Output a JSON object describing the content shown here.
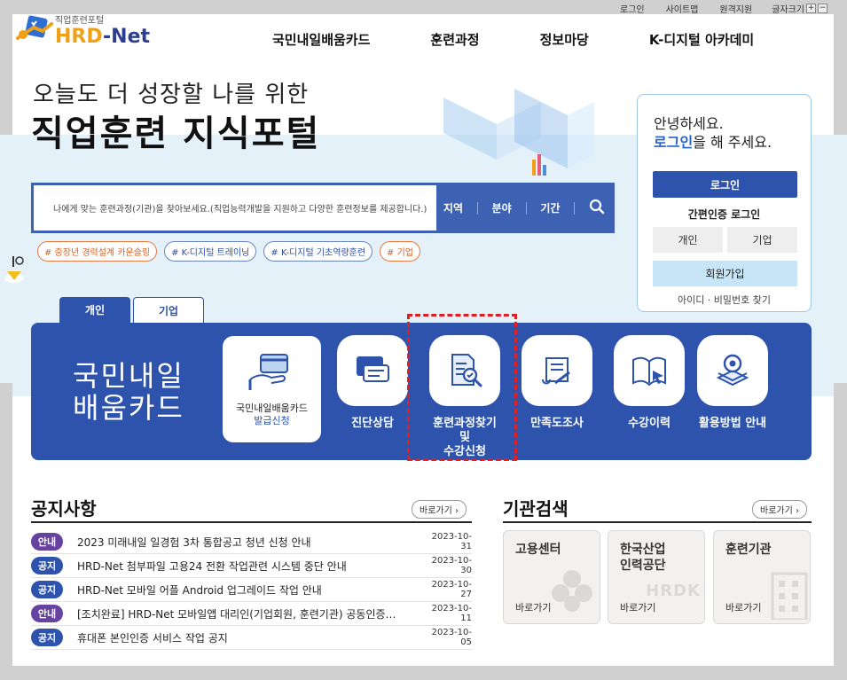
{
  "topbar": {
    "login": "로그인",
    "sitemap": "사이트맵",
    "remote": "원격지원",
    "font_size": "글자크기",
    "plus": "+",
    "minus": "−"
  },
  "logo": {
    "sub": "직업훈련포털",
    "main_a": "HRD",
    "main_b": "-Net"
  },
  "gnb": [
    "국민내일배움카드",
    "훈련과정",
    "정보마당",
    "K-디지털 아카데미"
  ],
  "hero": {
    "line1": "오늘도 더 성장할 나를 위한",
    "line2": "직업훈련 지식포털"
  },
  "search": {
    "placeholder": "나에게 맞는 훈련과정(기관)을 찾아보세요.(직업능력개발을 지원하고 다양한 훈련정보를 제공합니다.)",
    "filters": [
      "지역",
      "분야",
      "기간"
    ]
  },
  "tags": [
    "# 중장년 경력설계 카운슬링",
    "# K-디지털 트레이닝",
    "# K-디지털 기초역량훈련",
    "# 기업"
  ],
  "login_box": {
    "greet1": "안녕하세요.",
    "greet2a": "로그인",
    "greet2b": "을 해 주세요.",
    "login_btn": "로그인",
    "simple_login": "간편인증 로그인",
    "personal": "개인",
    "company": "기업",
    "join": "회원가입",
    "find": "아이디 · 비밀번호 찾기"
  },
  "tabs": {
    "personal": "개인",
    "company": "기업"
  },
  "panel": {
    "title1": "국민내일",
    "title2": "배움카드",
    "card_label1": "국민내일배움카드",
    "card_label2": "발급신청",
    "services": [
      {
        "label": "진단상담",
        "icon": "help-chat-icon"
      },
      {
        "label1": "훈련과정찾기 및",
        "label2": "수강신청",
        "icon": "document-search-icon"
      },
      {
        "label": "만족도조사",
        "icon": "survey-scroll-icon"
      },
      {
        "label": "수강이력",
        "icon": "book-cursor-icon"
      },
      {
        "label": "활용방법 안내",
        "icon": "gear-stack-icon"
      }
    ]
  },
  "notice": {
    "title": "공지사항",
    "more": "바로가기",
    "items": [
      {
        "badge": "안내",
        "text": "2023 미래내일 일경험 3차 통합공고 청년 신청 안내",
        "date": "2023-10-31"
      },
      {
        "badge": "공지",
        "text": "HRD-Net 첨부파일 고용24 전환 작업관련 시스템 중단 안내",
        "date": "2023-10-30"
      },
      {
        "badge": "공지",
        "text": "HRD-Net 모바일 어플 Android 업그레이드 작업 안내",
        "date": "2023-10-27"
      },
      {
        "badge": "안내",
        "text": "[조치완료] HRD-Net 모바일앱 대리인(기업회원, 훈련기관) 공동인증…",
        "date": "2023-10-11"
      },
      {
        "badge": "공지",
        "text": "휴대폰 본인인증 서비스 작업 공지",
        "date": "2023-10-05"
      }
    ]
  },
  "institution": {
    "title": "기관검색",
    "more": "바로가기",
    "cards": [
      {
        "name1": "고용센터",
        "name2": "",
        "go": "바로가기",
        "mark": ""
      },
      {
        "name1": "한국산업",
        "name2": "인력공단",
        "go": "바로가기",
        "mark": "HRDK"
      },
      {
        "name1": "훈련기관",
        "name2": "",
        "go": "바로가기",
        "mark": ""
      }
    ]
  },
  "colors": {
    "primary": "#2d53ad",
    "accent": "#f0a017",
    "band": "#e4f1f9",
    "highlight": "#e02020"
  }
}
